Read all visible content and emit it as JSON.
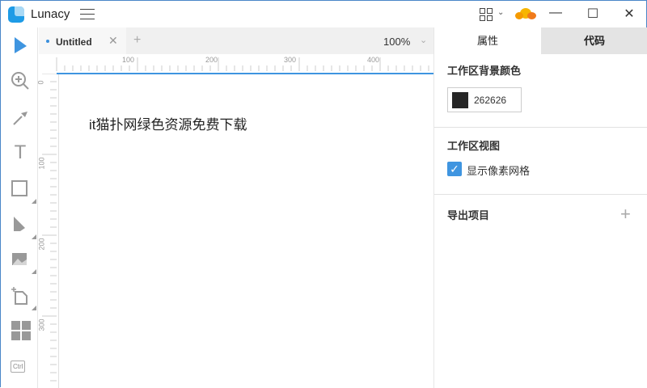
{
  "app": {
    "title": "Lunacy"
  },
  "tabs": {
    "doc_label": "Untitled",
    "zoom": "100%"
  },
  "ruler": {
    "h": [
      "100",
      "200",
      "300",
      "400"
    ],
    "v": [
      "0",
      "100",
      "200",
      "300"
    ]
  },
  "canvas": {
    "text": "it猫扑网绿色资源免费下载"
  },
  "panel": {
    "tabs": [
      "属性",
      "代码"
    ],
    "bg_section": "工作区背景颜色",
    "bg_color": "262626",
    "view_section": "工作区视图",
    "show_pixel_grid": "显示像素网格",
    "show_pixel_grid_checked": true,
    "export_section": "导出项目"
  },
  "toolbar": {
    "ctrl": "Ctrl"
  },
  "colors": {
    "accent": "#3f95e0",
    "swatch": "#262626"
  }
}
